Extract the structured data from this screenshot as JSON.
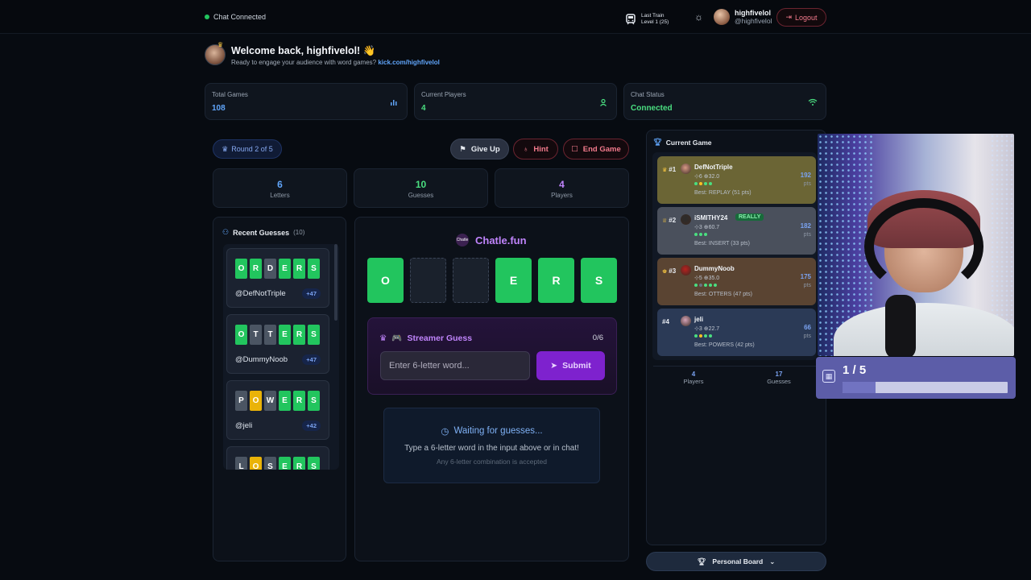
{
  "topbar": {
    "chat_status": "Chat Connected",
    "train_line1": "Last Train",
    "train_line2": "Level 1 (25)",
    "username": "highfivelol",
    "handle": "@highfivelol",
    "logout_label": "Logout"
  },
  "welcome": {
    "title": "Welcome back, highfivelol! 👋",
    "subtitle": "Ready to engage your audience with word games?",
    "link": "kick.com/highfivelol"
  },
  "stats": [
    {
      "label": "Total Games",
      "value": "108",
      "color": "#60a5fa",
      "icon": "bar-chart-icon"
    },
    {
      "label": "Current Players",
      "value": "4",
      "color": "#4ade80",
      "icon": "user-icon"
    },
    {
      "label": "Chat Status",
      "value": "Connected",
      "color": "#4ade80",
      "icon": "wifi-icon"
    }
  ],
  "controls": {
    "round": "Round 2 of 5",
    "give_up": "Give Up",
    "hint": "Hint",
    "end_game": "End Game"
  },
  "mini_stats": [
    {
      "value": "6",
      "label": "Letters",
      "color": "#60a5fa"
    },
    {
      "value": "10",
      "label": "Guesses",
      "color": "#4ade80"
    },
    {
      "value": "4",
      "label": "Players",
      "color": "#c084fc"
    }
  ],
  "recent": {
    "title": "Recent Guesses",
    "count": "(10)",
    "guesses": [
      {
        "letters": [
          "O",
          "R",
          "D",
          "E",
          "R",
          "S"
        ],
        "states": [
          "g",
          "g",
          "x",
          "g",
          "g",
          "g"
        ],
        "user": "@DefNotTriple",
        "pts": "+47"
      },
      {
        "letters": [
          "O",
          "T",
          "T",
          "E",
          "R",
          "S"
        ],
        "states": [
          "g",
          "x",
          "x",
          "g",
          "g",
          "g"
        ],
        "user": "@DummyNoob",
        "pts": "+47"
      },
      {
        "letters": [
          "P",
          "O",
          "W",
          "E",
          "R",
          "S"
        ],
        "states": [
          "x",
          "y",
          "x",
          "g",
          "g",
          "g"
        ],
        "user": "@jeli",
        "pts": "+42"
      },
      {
        "letters": [
          "L",
          "O",
          "S",
          "E",
          "R",
          "S"
        ],
        "states": [
          "x",
          "y",
          "x",
          "g",
          "g",
          "g"
        ],
        "user": "",
        "pts": ""
      }
    ]
  },
  "board": {
    "brand": "Chatle.fun",
    "brand_logo": "Chatle",
    "tiles": [
      "O",
      "",
      "",
      "E",
      "R",
      "S"
    ],
    "streamer_title": "Streamer Guess",
    "streamer_count": "0/6",
    "input_placeholder": "Enter 6-letter word...",
    "submit_label": "Submit",
    "waiting_title": "Waiting for guesses...",
    "waiting_sub": "Type a 6-letter word in the input above or in chat!",
    "waiting_note": "Any 6-letter combination is accepted"
  },
  "current_game": {
    "title": "Current Game",
    "players": [
      {
        "rank": "#1",
        "name": "DefNotTriple",
        "tag": "",
        "stats": "⊹6 ⊕32.0",
        "best": "Best: REPLAY (51 pts)",
        "pts": "192",
        "pts_label": "pts",
        "bg": "#6b6535",
        "dots": [
          "#4ade80",
          "#fbbf24",
          "#4ade80",
          "#4ade80"
        ]
      },
      {
        "rank": "#2",
        "name": "iSMITHY24",
        "tag": "REALLY",
        "stats": "⊹3 ⊕60.7",
        "best": "Best: INSERT (33 pts)",
        "pts": "182",
        "pts_label": "pts",
        "bg": "#4a505c",
        "dots": [
          "#4ade80",
          "#4ade80",
          "#4ade80"
        ]
      },
      {
        "rank": "#3",
        "name": "DummyNoob",
        "tag": "",
        "stats": "⊹5 ⊕35.0",
        "best": "Best: OTTERS (47 pts)",
        "pts": "175",
        "pts_label": "pts",
        "bg": "#5a4432",
        "dots": [
          "#4ade80",
          "#6b7280",
          "#4ade80",
          "#4ade80",
          "#4ade80"
        ]
      },
      {
        "rank": "#4",
        "name": "jeli",
        "tag": "",
        "stats": "⊹3 ⊕22.7",
        "best": "Best: POWERS (42 pts)",
        "pts": "66",
        "pts_label": "pts",
        "bg": "#2b3a56",
        "dots": [
          "#4ade80",
          "#fbbf24",
          "#4ade80",
          "#4ade80"
        ]
      }
    ],
    "footer_players": "4",
    "footer_players_label": "Players",
    "footer_guesses": "17",
    "footer_guesses_label": "Guesses",
    "personal_board": "Personal Board"
  },
  "goal": {
    "text": "1 / 5",
    "progress": 0.2
  }
}
